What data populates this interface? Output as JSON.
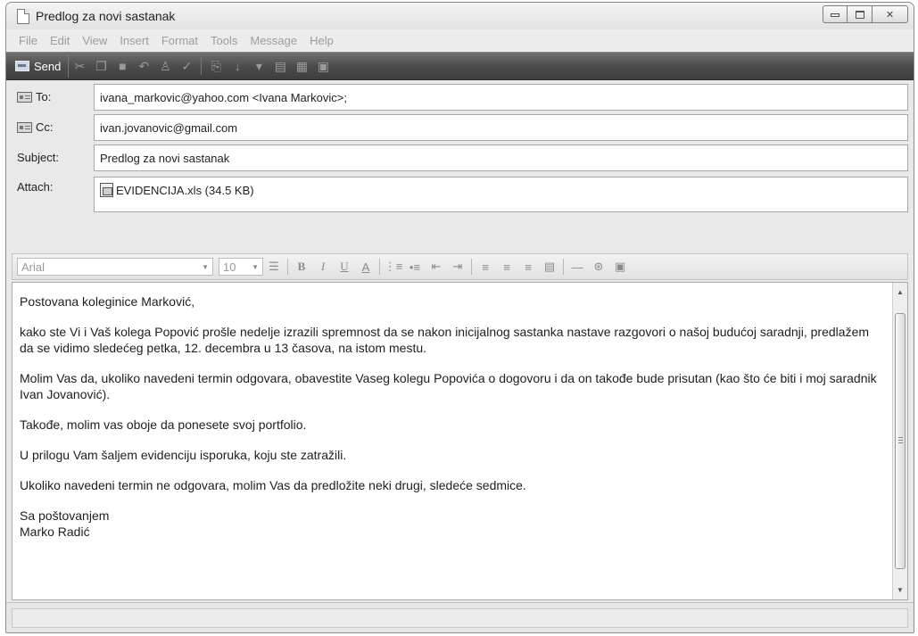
{
  "window": {
    "title": "Predlog za novi sastanak"
  },
  "menu": [
    "File",
    "Edit",
    "View",
    "Insert",
    "Format",
    "Tools",
    "Message",
    "Help"
  ],
  "toolbar": {
    "send_label": "Send",
    "icons": [
      "cut-icon",
      "copy-icon",
      "paste-icon",
      "undo-icon",
      "check-names-icon",
      "spelling-icon",
      "attach-icon",
      "priority-icon",
      "dropdown-icon",
      "sign-icon",
      "encrypt-icon",
      "offline-icon"
    ]
  },
  "headers": {
    "to_label": "To:",
    "to_value": "ivana_markovic@yahoo.com <Ivana Markovic>;",
    "cc_label": "Cc:",
    "cc_value": "ivan.jovanovic@gmail.com",
    "subject_label": "Subject:",
    "subject_value": "Predlog za novi sastanak",
    "attach_label": "Attach:",
    "attachment": "EVIDENCIJA.xls (34.5 KB)"
  },
  "format_bar": {
    "font": "Arial",
    "size": "10"
  },
  "message": {
    "greeting": "Postovana koleginice Marković,",
    "p1": "kako ste Vi i Vaš kolega Popović prošle nedelje izrazili spremnost da se nakon inicijalnog sastanka nastave razgovori o našoj budućoj saradnji, predlažem da se vidimo sledećeg petka, 12. decembra u 13 časova, na istom mestu.",
    "p2": "Molim Vas da, ukoliko navedeni termin odgovara, obavestite Vaseg kolegu Popovića o dogovoru i da on takođe bude prisutan (kao što će biti i moj saradnik Ivan Jovanović).",
    "p3": "Takođe, molim vas oboje da ponesete svoj portfolio.",
    "p4": "U prilogu Vam šaljem evidenciju isporuka, koju ste zatražili.",
    "p5": "Ukoliko navedeni termin ne odgovara, molim Vas da predložite neki drugi, sledeće sedmice.",
    "closing": "Sa poštovanjem",
    "signature": "Marko Radić"
  }
}
